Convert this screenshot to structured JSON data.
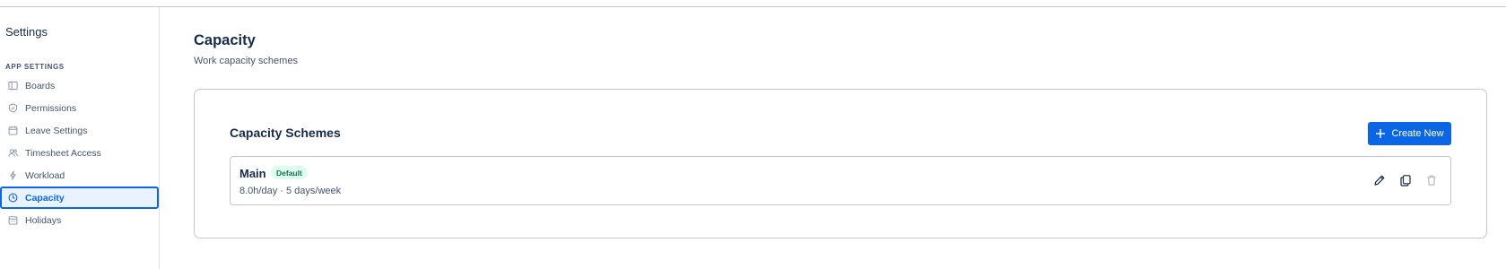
{
  "sidebar": {
    "title": "Settings",
    "section_label": "APP SETTINGS",
    "items": [
      {
        "label": "Boards",
        "icon": "board-icon"
      },
      {
        "label": "Permissions",
        "icon": "shield-icon"
      },
      {
        "label": "Leave Settings",
        "icon": "calendar-icon"
      },
      {
        "label": "Timesheet Access",
        "icon": "users-icon"
      },
      {
        "label": "Workload",
        "icon": "lightning-icon"
      },
      {
        "label": "Capacity",
        "icon": "clock-icon",
        "active": true
      },
      {
        "label": "Holidays",
        "icon": "calendar-holiday-icon"
      }
    ]
  },
  "page": {
    "title": "Capacity",
    "subtitle": "Work capacity schemes"
  },
  "card": {
    "title": "Capacity Schemes",
    "create_label": "Create New",
    "schemes": [
      {
        "name": "Main",
        "badge": "Default",
        "meta": "8.0h/day · 5 days/week"
      }
    ]
  },
  "colors": {
    "accent": "#0c66e4",
    "badge_bg": "#dcfff1",
    "badge_text": "#216e4e",
    "active_bg": "#e9f2ff"
  }
}
